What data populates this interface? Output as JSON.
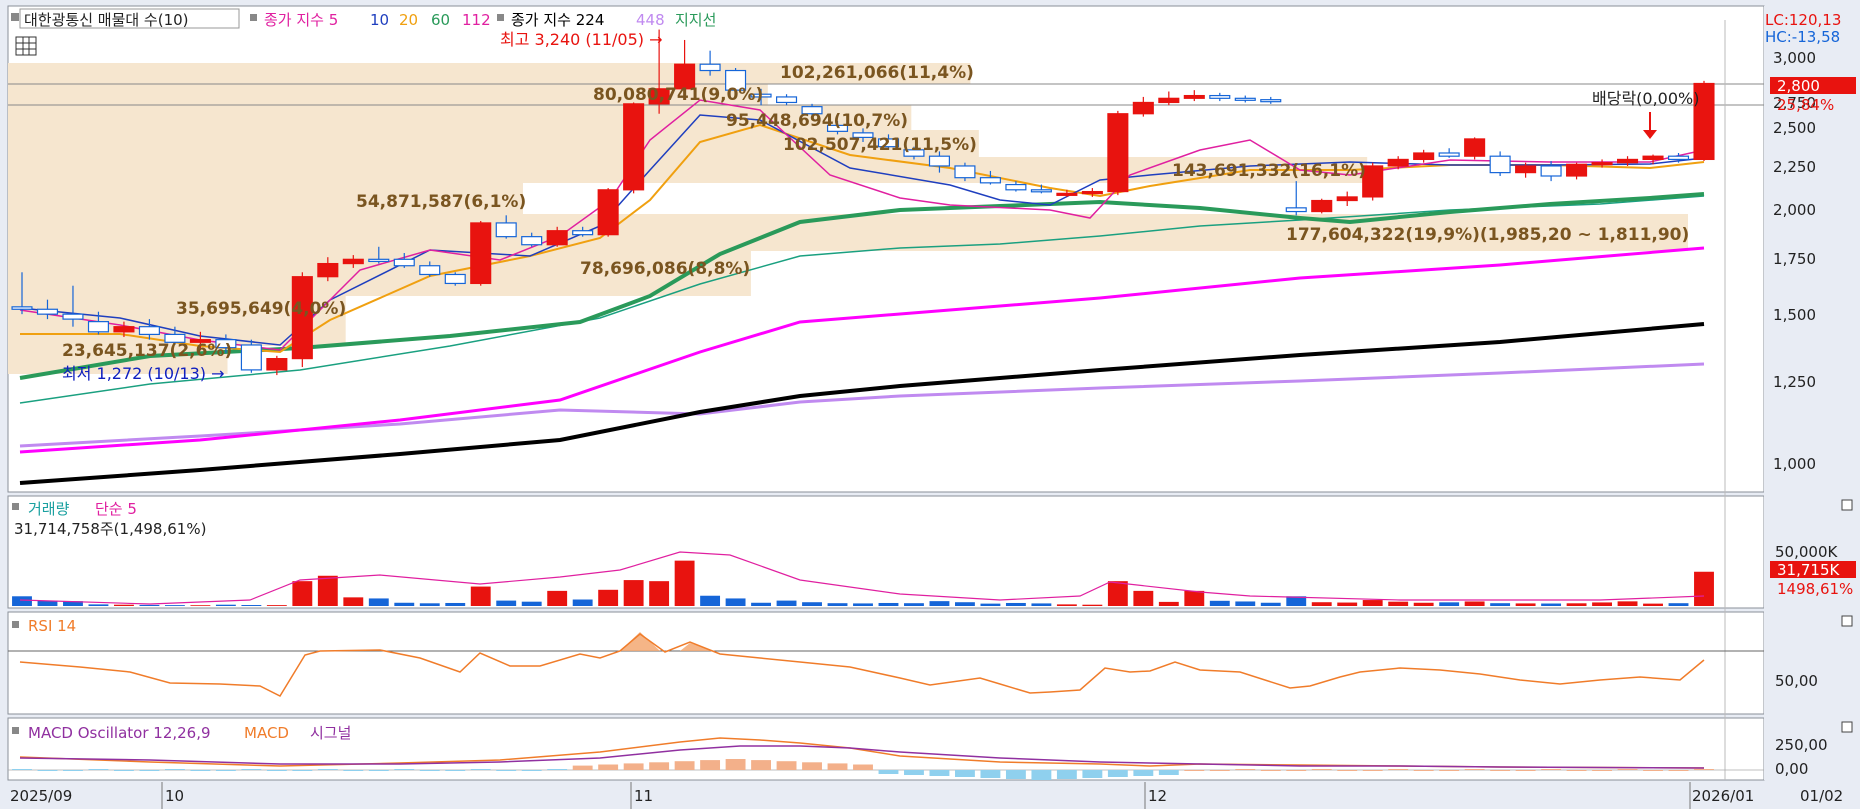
{
  "price_panel": {
    "legend": [
      "대한광통신 매물대 수(10)",
      "종가 지수 5",
      "10",
      "20",
      "60",
      "112",
      "종가 지수 224",
      "448",
      "지지선"
    ],
    "lc_label": "LC:120,13",
    "hc_label": "HC:-13,58",
    "high_marker": "최고 3,240 (11/05) →",
    "low_marker": "최저 1,272 (10/13) →",
    "dividend_label": "배당락(0,00%)",
    "current_price": "2,800",
    "current_change": "25,84%",
    "ticks": [
      "3,000",
      "2,750",
      "2,500",
      "2,250",
      "2,000",
      "1,750",
      "1,500",
      "1,250",
      "1,000"
    ],
    "volume_profile": [
      "102,261,066(11,4%)",
      "80,080,741(9,0%)",
      "95,448,694(10,7%)",
      "102,507,421(11,5%)",
      "143,691,332(16,1%)",
      "54,871,587(6,1%)",
      "177,604,322(19,9%)(1,985,20 ~ 1,811,90)",
      "78,696,086(8,8%)",
      "35,695,649(4,0%)",
      "23,645,137(2,6%)"
    ]
  },
  "volume_panel": {
    "legend": [
      "거래량",
      "단순 5"
    ],
    "summary": "31,714,758주(1,498,61%)",
    "tick": "50,000K",
    "current": "31,715K",
    "current_pct": "1498,61%"
  },
  "rsi_panel": {
    "legend": [
      "RSI 14"
    ],
    "tick": "50,00"
  },
  "macd_panel": {
    "legend": [
      "MACD Oscillator 12,26,9",
      "MACD",
      "시그널"
    ],
    "ticks": [
      "250,00",
      "0,00"
    ]
  },
  "x_axis": {
    "labels": [
      "2025/09",
      "10",
      "11",
      "12",
      "2026/01"
    ],
    "right_label": "01/02"
  },
  "colors": {
    "up": "#e8130f",
    "down": "#1565d8",
    "ma5": "#e020a0",
    "ma10": "#1f3fbf",
    "ma20": "#f0a010",
    "ma60": "#2a9a5a",
    "ma112": "#1aa080",
    "ma224": "#000000",
    "ma448": "#c08af0",
    "support": "#ff00ff"
  },
  "chart_data": {
    "type": "candlestick",
    "y_scale": "log",
    "ylim": [
      1000,
      3000
    ],
    "high": {
      "value": 3240,
      "date": "11/05"
    },
    "low": {
      "value": 1272,
      "date": "10/13"
    },
    "candles_ohlc": [
      [
        1530,
        1680,
        1500,
        1520
      ],
      [
        1520,
        1560,
        1480,
        1500
      ],
      [
        1500,
        1620,
        1450,
        1480
      ],
      [
        1470,
        1510,
        1420,
        1430
      ],
      [
        1430,
        1470,
        1410,
        1450
      ],
      [
        1450,
        1480,
        1400,
        1420
      ],
      [
        1420,
        1450,
        1380,
        1390
      ],
      [
        1390,
        1430,
        1360,
        1400
      ],
      [
        1400,
        1420,
        1350,
        1370
      ],
      [
        1380,
        1400,
        1280,
        1290
      ],
      [
        1290,
        1340,
        1272,
        1330
      ],
      [
        1330,
        1680,
        1300,
        1660
      ],
      [
        1660,
        1750,
        1640,
        1720
      ],
      [
        1720,
        1760,
        1700,
        1740
      ],
      [
        1740,
        1800,
        1720,
        1730
      ],
      [
        1740,
        1770,
        1700,
        1710
      ],
      [
        1710,
        1730,
        1660,
        1670
      ],
      [
        1670,
        1680,
        1620,
        1630
      ],
      [
        1630,
        1930,
        1620,
        1920
      ],
      [
        1920,
        1960,
        1840,
        1850
      ],
      [
        1850,
        1870,
        1800,
        1810
      ],
      [
        1810,
        1900,
        1800,
        1880
      ],
      [
        1880,
        1900,
        1850,
        1860
      ],
      [
        1860,
        2110,
        1850,
        2100
      ],
      [
        2100,
        2660,
        2080,
        2650
      ],
      [
        2650,
        3240,
        2580,
        2760
      ],
      [
        2760,
        3150,
        2680,
        2950
      ],
      [
        2950,
        3060,
        2860,
        2900
      ],
      [
        2900,
        2920,
        2740,
        2750
      ],
      [
        2720,
        2760,
        2640,
        2700
      ],
      [
        2700,
        2720,
        2640,
        2660
      ],
      [
        2630,
        2650,
        2560,
        2580
      ],
      [
        2500,
        2530,
        2440,
        2460
      ],
      [
        2450,
        2480,
        2390,
        2420
      ],
      [
        2410,
        2440,
        2340,
        2360
      ],
      [
        2340,
        2360,
        2280,
        2300
      ],
      [
        2300,
        2330,
        2200,
        2240
      ],
      [
        2240,
        2260,
        2150,
        2170
      ],
      [
        2170,
        2210,
        2130,
        2140
      ],
      [
        2130,
        2150,
        2090,
        2100
      ],
      [
        2100,
        2130,
        2080,
        2090
      ],
      [
        2080,
        2100,
        2060,
        2080
      ],
      [
        2080,
        2110,
        2060,
        2090
      ],
      [
        2090,
        2600,
        2070,
        2580
      ],
      [
        2580,
        2700,
        2560,
        2660
      ],
      [
        2660,
        2740,
        2640,
        2690
      ],
      [
        2690,
        2750,
        2670,
        2710
      ],
      [
        2710,
        2730,
        2670,
        2690
      ],
      [
        2690,
        2710,
        2660,
        2680
      ],
      [
        2680,
        2700,
        2650,
        2670
      ],
      [
        2000,
        2150,
        1960,
        1980
      ],
      [
        1980,
        2050,
        1970,
        2040
      ],
      [
        2040,
        2090,
        2010,
        2060
      ],
      [
        2060,
        2260,
        2040,
        2240
      ],
      [
        2240,
        2300,
        2220,
        2280
      ],
      [
        2280,
        2340,
        2260,
        2320
      ],
      [
        2320,
        2350,
        2290,
        2300
      ],
      [
        2300,
        2420,
        2280,
        2410
      ],
      [
        2300,
        2330,
        2180,
        2200
      ],
      [
        2200,
        2260,
        2170,
        2240
      ],
      [
        2240,
        2270,
        2150,
        2180
      ],
      [
        2180,
        2260,
        2160,
        2250
      ],
      [
        2250,
        2280,
        2230,
        2260
      ],
      [
        2260,
        2300,
        2240,
        2280
      ],
      [
        2280,
        2310,
        2250,
        2300
      ],
      [
        2300,
        2320,
        2260,
        2280
      ],
      [
        2280,
        2820,
        2270,
        2800
      ]
    ],
    "volume_bars_k": [
      9000,
      5000,
      4500,
      1500,
      1200,
      1000,
      800,
      700,
      1200,
      900,
      800,
      23000,
      28000,
      8000,
      7000,
      3000,
      2500,
      2800,
      18000,
      5000,
      4000,
      14000,
      6000,
      15000,
      24000,
      23000,
      42000,
      9500,
      7000,
      3000,
      5000,
      3500,
      2600,
      2400,
      2800,
      2600,
      4500,
      3500,
      2200,
      2800,
      2400,
      1500,
      1200,
      23000,
      14000,
      3800,
      14000,
      4800,
      4200,
      3000,
      9000,
      3500,
      3200,
      5500,
      4000,
      3000,
      3400,
      4200,
      2600,
      2400,
      2300,
      2500,
      3300,
      4300,
      2200,
      2600,
      31715
    ],
    "volume_profile_pct": [
      11.4,
      9.0,
      10.7,
      11.5,
      16.1,
      6.1,
      19.9,
      8.8,
      4.0,
      2.6
    ]
  }
}
